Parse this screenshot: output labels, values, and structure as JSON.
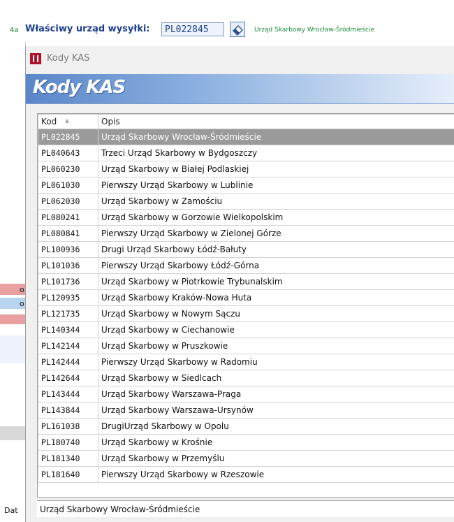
{
  "form": {
    "field_number": "4a",
    "field_label": "Właściwy urząd wysyłki:",
    "code_value": "PL022845",
    "office_name": "Urząd Skarbowy Wrocław-Śródmieście",
    "left_label": "Dat",
    "left_marks": [
      "o",
      "o"
    ]
  },
  "dialog": {
    "window_title": "Kody KAS",
    "banner_title": "Kody KAS",
    "columns": [
      "Kod",
      "Opis"
    ],
    "rows": [
      {
        "kod": "PL022845",
        "opis": "Urząd Skarbowy Wrocław-Śródmieście",
        "selected": true
      },
      {
        "kod": "PL040643",
        "opis": "Trzeci Urząd Skarbowy w Bydgoszczy"
      },
      {
        "kod": "PL060230",
        "opis": "Urząd Skarbowy w Białej Podlaskiej"
      },
      {
        "kod": "PL061030",
        "opis": "Pierwszy Urząd Skarbowy w Lublinie"
      },
      {
        "kod": "PL062030",
        "opis": "Urząd Skarbowy w Zamościu"
      },
      {
        "kod": "PL080241",
        "opis": "Urząd Skarbowy w Gorzowie Wielkopolskim"
      },
      {
        "kod": "PL080841",
        "opis": "Pierwszy Urząd Skarbowy w Zielonej Górze"
      },
      {
        "kod": "PL100936",
        "opis": "Drugi Urząd Skarbowy Łódź-Bałuty"
      },
      {
        "kod": "PL101036",
        "opis": "Pierwszy Urząd Skarbowy Łódź-Górna"
      },
      {
        "kod": "PL101736",
        "opis": "Urząd Skarbowy w Piotrkowie Trybunalskim"
      },
      {
        "kod": "PL120935",
        "opis": "Urząd Skarbowy Kraków-Nowa Huta"
      },
      {
        "kod": "PL121735",
        "opis": "Urząd Skarbowy w Nowym Sączu"
      },
      {
        "kod": "PL140344",
        "opis": "Urząd Skarbowy w Ciechanowie"
      },
      {
        "kod": "PL142144",
        "opis": "Urząd Skarbowy w Pruszkowie"
      },
      {
        "kod": "PL142444",
        "opis": "Pierwszy Urząd Skarbowy w Radomiu"
      },
      {
        "kod": "PL142644",
        "opis": "Urząd Skarbowy w Siedlcach"
      },
      {
        "kod": "PL143444",
        "opis": "Urząd Skarbowy Warszawa-Praga"
      },
      {
        "kod": "PL143844",
        "opis": "Urząd Skarbowy Warszawa-Ursynów"
      },
      {
        "kod": "PL161038",
        "opis": "DrugiUrząd Skarbowy w Opolu"
      },
      {
        "kod": "PL180740",
        "opis": "Urząd Skarbowy w Krośnie"
      },
      {
        "kod": "PL181340",
        "opis": "Urząd Skarbowy w Przemyślu"
      },
      {
        "kod": "PL181640",
        "opis": "Pierwszy Urząd Skarbowy w Rzeszowie"
      }
    ],
    "status_text": "Urząd Skarbowy Wrocław-Śródmieście"
  },
  "colors": {
    "selected_row": "#9a9a9a",
    "banner": "#5a87c9",
    "field_label": "#1c3f8c",
    "office_name": "#1a8a3c",
    "left_mark_red": "#e8a0a0",
    "left_mark_blue": "#b8d4ef"
  }
}
